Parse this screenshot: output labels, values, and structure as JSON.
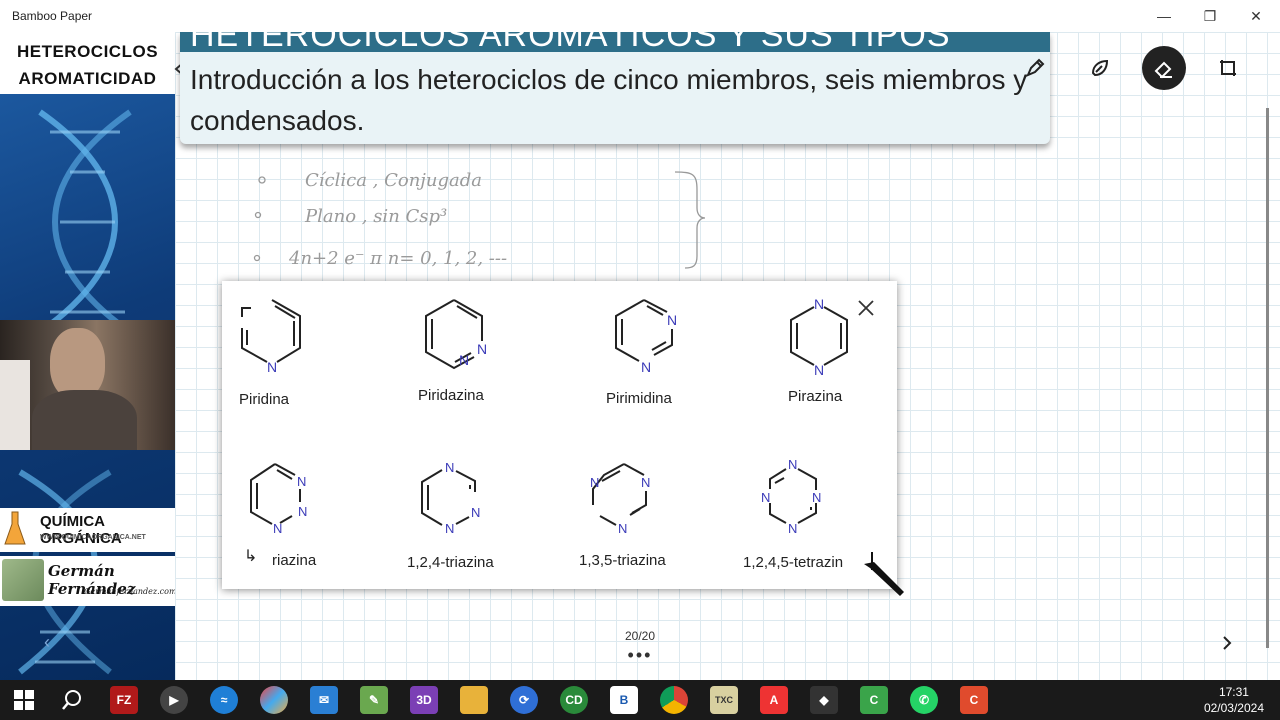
{
  "window": {
    "title": "Bamboo Paper",
    "minimize": "—",
    "restore": "❐",
    "close": "✕"
  },
  "left_panel": {
    "heading_line1": "HETEROCICLOS",
    "heading_line2": "AROMATICIDAD",
    "logo1_title": "QUÍMICA ORGÁNICA",
    "logo1_url": "WWW.QUIMICAORGANICA.NET",
    "logo2_name": "Germán Fernández",
    "logo2_site": "Germanfernandez.com"
  },
  "slide": {
    "title_bar": "HETEROCICLOS AROMÁTICOS Y SUS TIPOS",
    "text": "Introducción a los heterociclos de cinco miembros, seis miembros y condensados."
  },
  "handwriting": {
    "line1": "Cíclica , Conjugada",
    "line2": "Plano , sin Csp³",
    "line3": "4n+2 e⁻ π      n= 0, 1, 2, ---"
  },
  "molecules": [
    {
      "name": "Piridina"
    },
    {
      "name": "Piridazina"
    },
    {
      "name": "Pirimidina"
    },
    {
      "name": "Pirazina"
    },
    {
      "name": "riazina"
    },
    {
      "name": "1,2,4-triazina"
    },
    {
      "name": "1,3,5-triazina"
    },
    {
      "name": "1,2,4,5-tetrazin"
    }
  ],
  "ring_atom": "N",
  "pager": {
    "page": "20/20",
    "more": "•••"
  },
  "taskbar": {
    "time": "17:31",
    "date": "02/03/2024",
    "icons": [
      {
        "name": "windows-start-icon"
      },
      {
        "name": "search-icon"
      },
      {
        "name": "filezilla-icon",
        "label": "FZ"
      },
      {
        "name": "media-player-icon"
      },
      {
        "name": "app-blue-icon"
      },
      {
        "name": "paint-icon"
      },
      {
        "name": "mail-icon"
      },
      {
        "name": "notepad-icon"
      },
      {
        "name": "3d-viewer-icon",
        "label": "3D"
      },
      {
        "name": "file-explorer-icon"
      },
      {
        "name": "sync-icon"
      },
      {
        "name": "chemdraw-icon",
        "label": "CD"
      },
      {
        "name": "bamboo-paper-icon"
      },
      {
        "name": "chrome-icon"
      },
      {
        "name": "texstudio-icon",
        "label": "TXC"
      },
      {
        "name": "acrobat-icon"
      },
      {
        "name": "inkscape-icon"
      },
      {
        "name": "camtasia-icon"
      },
      {
        "name": "whatsapp-icon"
      },
      {
        "name": "camtasia-recorder-icon"
      }
    ]
  },
  "colors": {
    "title_bar": "#2d6e89",
    "nitrogen": "#3b3bb8",
    "taskbar": "#1a1a1a"
  }
}
